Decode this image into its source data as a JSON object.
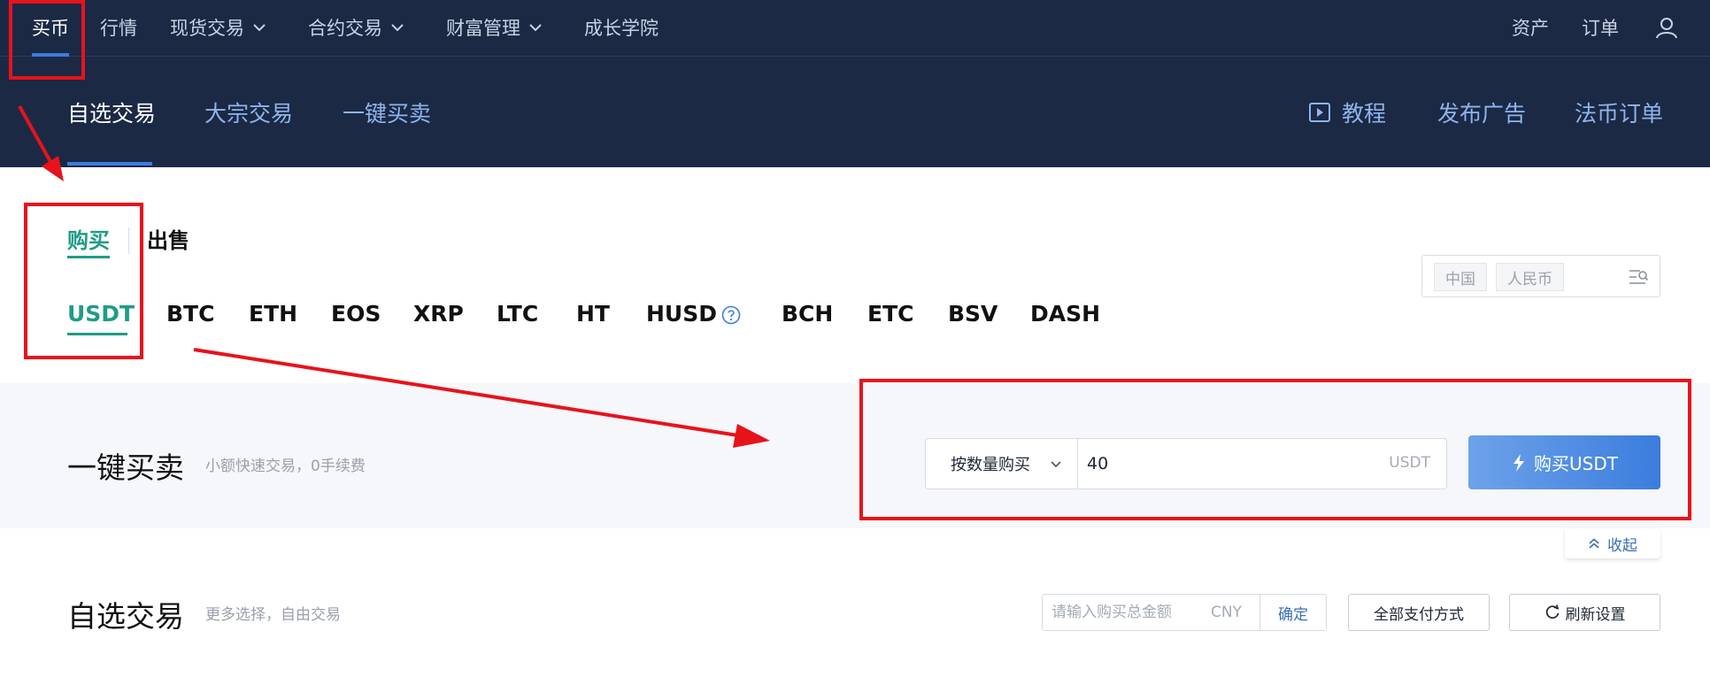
{
  "topnav": {
    "items": [
      {
        "label": "买币"
      },
      {
        "label": "行情"
      },
      {
        "label": "现货交易"
      },
      {
        "label": "合约交易"
      },
      {
        "label": "财富管理"
      },
      {
        "label": "成长学院"
      }
    ],
    "assets": "资产",
    "orders": "订单",
    "user_icon": "user-icon"
  },
  "subnav": {
    "tabs": [
      {
        "label": "自选交易"
      },
      {
        "label": "大宗交易"
      },
      {
        "label": "一键买卖"
      }
    ],
    "tutorial": "教程",
    "post_ad": "发布广告",
    "fiat_orders": "法币订单"
  },
  "trade_side": {
    "buy": "购买",
    "sell": "出售"
  },
  "coins": [
    "USDT",
    "BTC",
    "ETH",
    "EOS",
    "XRP",
    "LTC",
    "HT",
    "HUSD",
    "BCH",
    "ETC",
    "BSV",
    "DASH"
  ],
  "region": {
    "country": "中国",
    "currency": "人民币"
  },
  "quick_trade": {
    "title": "一键买卖",
    "subtitle": "小额快速交易，0手续费",
    "mode": "按数量购买",
    "amount": "40",
    "unit": "USDT",
    "buy_button": "购买USDT"
  },
  "collapse_label": "收起",
  "self_select": {
    "title": "自选交易",
    "subtitle": "更多选择，自由交易",
    "total_placeholder": "请输入购买总金额",
    "total_unit": "CNY",
    "confirm": "确定",
    "payment_methods": "全部支付方式",
    "refresh_settings": "刷新设置"
  },
  "colors": {
    "nav_bg": "#1b2945",
    "accent_blue": "#3b7ddd",
    "accent_green": "#1f9c86",
    "annotation_red": "#e8121b"
  }
}
